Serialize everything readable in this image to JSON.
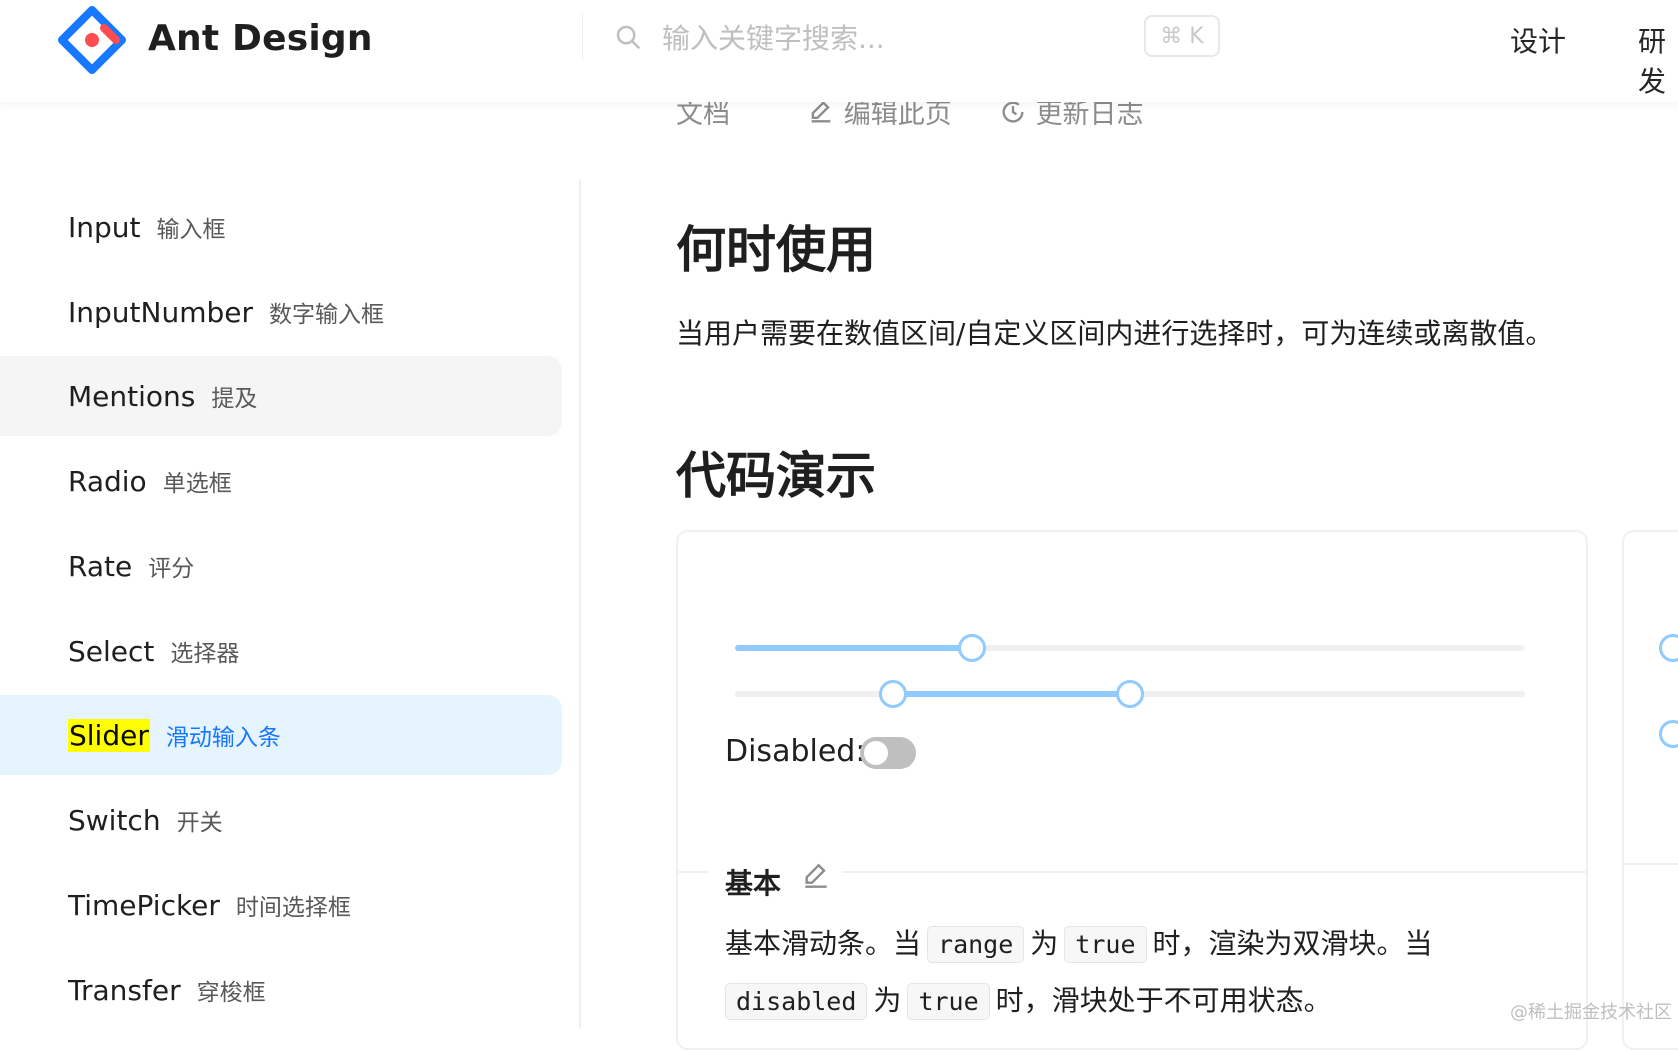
{
  "header": {
    "logo_text": "Ant Design",
    "search_placeholder": "输入关键字搜索...",
    "shortcut": "⌘ K",
    "nav": [
      "设计",
      "研发"
    ]
  },
  "subbar": {
    "doc_label": "文档",
    "edit_label": "编辑此页",
    "changelog_label": "更新日志"
  },
  "sidebar": {
    "items": [
      {
        "en": "Input",
        "cn": "输入框"
      },
      {
        "en": "InputNumber",
        "cn": "数字输入框"
      },
      {
        "en": "Mentions",
        "cn": "提及"
      },
      {
        "en": "Radio",
        "cn": "单选框"
      },
      {
        "en": "Rate",
        "cn": "评分"
      },
      {
        "en": "Select",
        "cn": "选择器"
      },
      {
        "en": "Slider",
        "cn": "滑动输入条"
      },
      {
        "en": "Switch",
        "cn": "开关"
      },
      {
        "en": "TimePicker",
        "cn": "时间选择框"
      },
      {
        "en": "Transfer",
        "cn": "穿梭框"
      }
    ],
    "hovered_item": "Mentions",
    "active_item": "Slider"
  },
  "main": {
    "when_to_use_title": "何时使用",
    "when_to_use_desc": "当用户需要在数值区间/自定义区间内进行选择时，可为连续或离散值。",
    "demo_title": "代码演示",
    "demo": {
      "slider_single_value": 30,
      "slider_range_values": [
        20,
        50
      ],
      "switch_label": "Disabled:",
      "switch_on": false,
      "meta_title": "基本",
      "desc_part1": "基本滑动条。当",
      "code_range": "range",
      "desc_part2": "为",
      "code_true": "true",
      "desc_part3": "时，渲染为双滑块。当",
      "code_disabled": "disabled",
      "desc_part4": "为",
      "code_true2": "true",
      "desc_part5": "时，滑块处于不可用状态。"
    }
  },
  "watermark": "@稀土掘金技术社区",
  "colors": {
    "primary": "#1677ff",
    "slider_track": "#91caff",
    "active_bg": "#e6f4ff",
    "highlight": "#ffff00"
  }
}
